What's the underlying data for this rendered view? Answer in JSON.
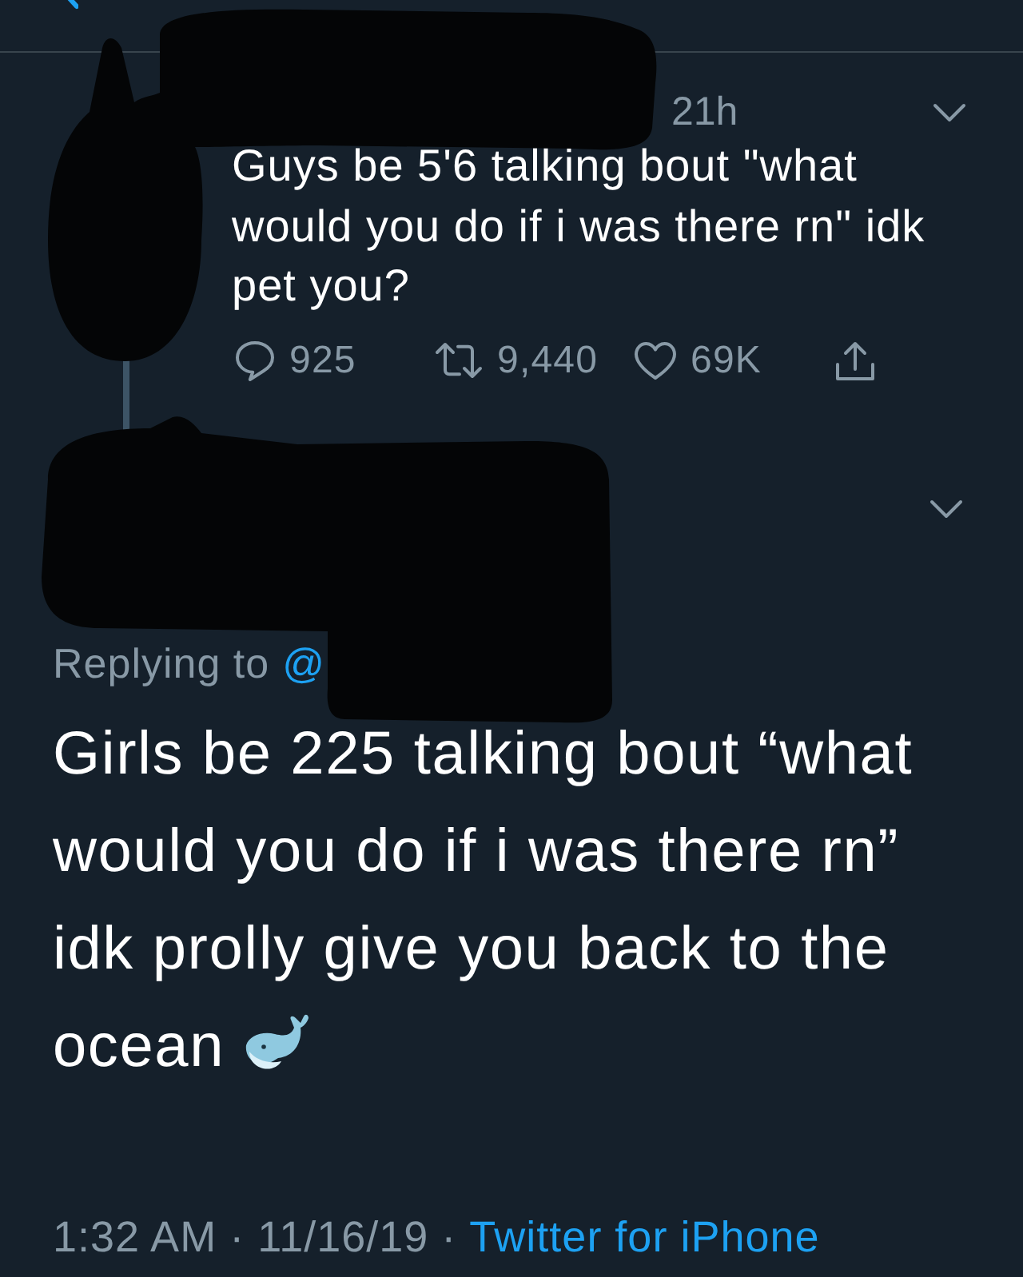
{
  "tweets": [
    {
      "kind": "parent",
      "author_redacted": true,
      "time": "21h",
      "text_lines": [
        "Guys be 5'6 talking bout \"what",
        "would you do if i was there rn\" idk",
        "pet you?"
      ],
      "actions": [
        {
          "kind": "reply",
          "count": "925"
        },
        {
          "kind": "retweet",
          "count": "9,440"
        },
        {
          "kind": "like",
          "count": "69K"
        },
        {
          "kind": "share"
        }
      ]
    },
    {
      "kind": "focus",
      "author_redacted": true,
      "replying_to": {
        "label": "Replying to",
        "mention": "@"
      },
      "text_lines": [
        "Girls be 225 talking bout “what",
        "would you do if i was there rn”",
        "idk prolly give you back to the",
        "ocean"
      ],
      "meta": {
        "parts": [
          "1:32 AM",
          "11/16/19"
        ],
        "separator": "·",
        "source": "Twitter for iPhone"
      }
    }
  ]
}
